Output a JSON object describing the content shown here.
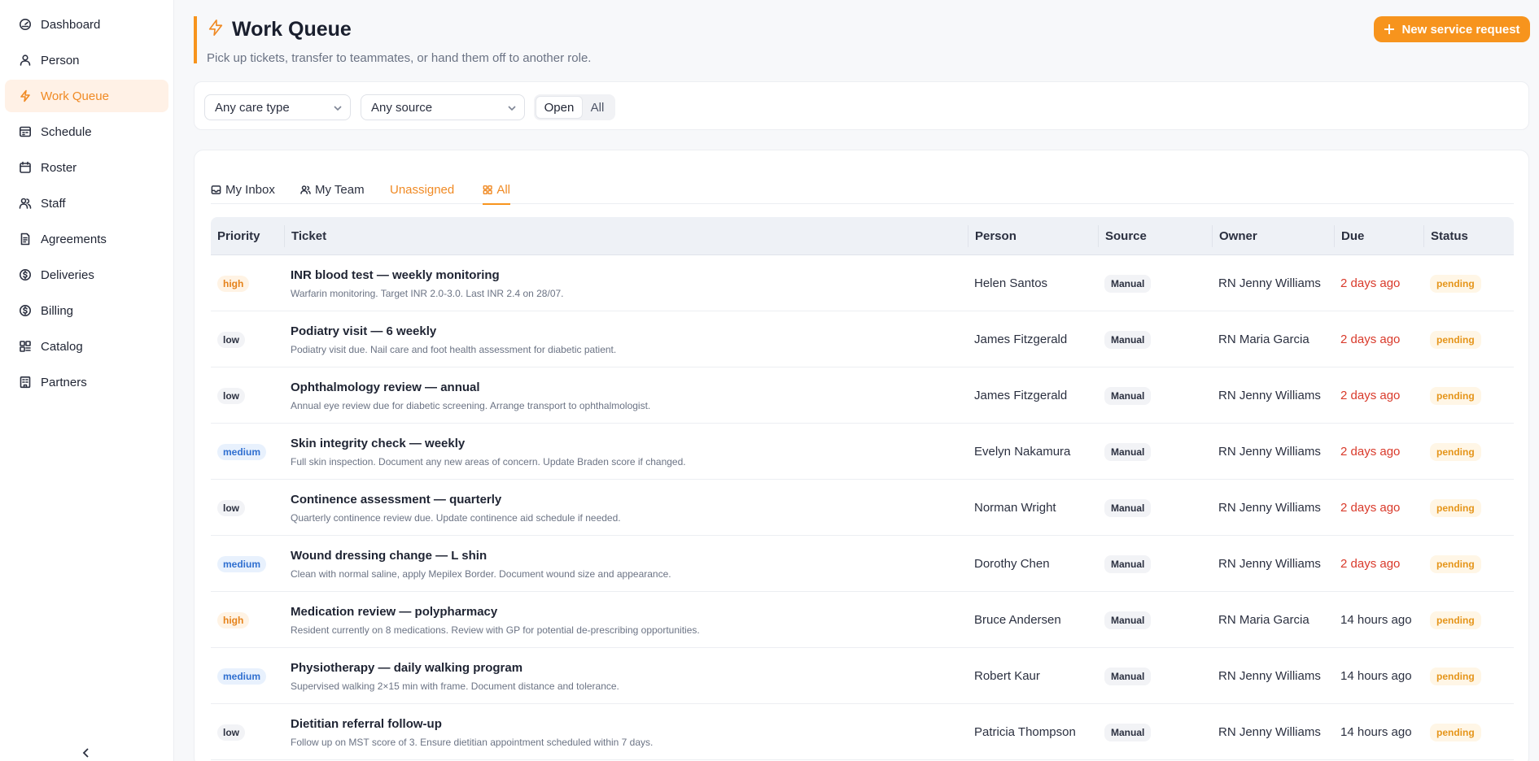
{
  "sidebar": {
    "items": [
      {
        "label": "Dashboard",
        "icon": "gauge-icon"
      },
      {
        "label": "Person",
        "icon": "user-icon"
      },
      {
        "label": "Work Queue",
        "icon": "bolt-icon",
        "active": true
      },
      {
        "label": "Schedule",
        "icon": "schedule-icon"
      },
      {
        "label": "Roster",
        "icon": "calendar-icon"
      },
      {
        "label": "Staff",
        "icon": "users-icon"
      },
      {
        "label": "Agreements",
        "icon": "document-icon"
      },
      {
        "label": "Deliveries",
        "icon": "dollar-circle-icon"
      },
      {
        "label": "Billing",
        "icon": "dollar-circle-icon"
      },
      {
        "label": "Catalog",
        "icon": "catalog-icon"
      },
      {
        "label": "Partners",
        "icon": "building-icon"
      }
    ]
  },
  "header": {
    "title": "Work Queue",
    "subtitle": "Pick up tickets, transfer to teammates, or hand them off to another role.",
    "new_button": "New service request"
  },
  "filters": {
    "care_type": "Any care type",
    "source": "Any source",
    "toggle": {
      "open": "Open",
      "all": "All",
      "selected": "Open"
    }
  },
  "tabs": [
    {
      "label": "My Inbox",
      "icon": "inbox-icon"
    },
    {
      "label": "My Team",
      "icon": "team-icon"
    },
    {
      "label": "Unassigned",
      "icon": ""
    },
    {
      "label": "All",
      "icon": "grid-icon",
      "active": true
    }
  ],
  "table": {
    "columns": [
      "Priority",
      "Ticket",
      "Person",
      "Source",
      "Owner",
      "Due",
      "Status"
    ],
    "rows": [
      {
        "priority": "high",
        "title": "INR blood test — weekly monitoring",
        "desc": "Warfarin monitoring. Target INR 2.0-3.0. Last INR 2.4 on 28/07.",
        "person": "Helen Santos",
        "source": "Manual",
        "owner": "RN Jenny Williams",
        "due": "2 days ago",
        "overdue": true,
        "status": "pending"
      },
      {
        "priority": "low",
        "title": "Podiatry visit — 6 weekly",
        "desc": "Podiatry visit due. Nail care and foot health assessment for diabetic patient.",
        "person": "James Fitzgerald",
        "source": "Manual",
        "owner": "RN Maria Garcia",
        "due": "2 days ago",
        "overdue": true,
        "status": "pending"
      },
      {
        "priority": "low",
        "title": "Ophthalmology review — annual",
        "desc": "Annual eye review due for diabetic screening. Arrange transport to ophthalmologist.",
        "person": "James Fitzgerald",
        "source": "Manual",
        "owner": "RN Jenny Williams",
        "due": "2 days ago",
        "overdue": true,
        "status": "pending"
      },
      {
        "priority": "medium",
        "title": "Skin integrity check — weekly",
        "desc": "Full skin inspection. Document any new areas of concern. Update Braden score if changed.",
        "person": "Evelyn Nakamura",
        "source": "Manual",
        "owner": "RN Jenny Williams",
        "due": "2 days ago",
        "overdue": true,
        "status": "pending"
      },
      {
        "priority": "low",
        "title": "Continence assessment — quarterly",
        "desc": "Quarterly continence review due. Update continence aid schedule if needed.",
        "person": "Norman Wright",
        "source": "Manual",
        "owner": "RN Jenny Williams",
        "due": "2 days ago",
        "overdue": true,
        "status": "pending"
      },
      {
        "priority": "medium",
        "title": "Wound dressing change — L shin",
        "desc": "Clean with normal saline, apply Mepilex Border. Document wound size and appearance.",
        "person": "Dorothy Chen",
        "source": "Manual",
        "owner": "RN Jenny Williams",
        "due": "2 days ago",
        "overdue": true,
        "status": "pending"
      },
      {
        "priority": "high",
        "title": "Medication review — polypharmacy",
        "desc": "Resident currently on 8 medications. Review with GP for potential de-prescribing opportunities.",
        "person": "Bruce Andersen",
        "source": "Manual",
        "owner": "RN Maria Garcia",
        "due": "14 hours ago",
        "overdue": false,
        "status": "pending"
      },
      {
        "priority": "medium",
        "title": "Physiotherapy — daily walking program",
        "desc": "Supervised walking 2×15 min with frame. Document distance and tolerance.",
        "person": "Robert Kaur",
        "source": "Manual",
        "owner": "RN Jenny Williams",
        "due": "14 hours ago",
        "overdue": false,
        "status": "pending"
      },
      {
        "priority": "low",
        "title": "Dietitian referral follow-up",
        "desc": "Follow up on MST score of 3. Ensure dietitian appointment scheduled within 7 days.",
        "person": "Patricia Thompson",
        "source": "Manual",
        "owner": "RN Jenny Williams",
        "due": "14 hours ago",
        "overdue": false,
        "status": "pending"
      }
    ]
  },
  "colors": {
    "accent": "#f7941d",
    "overdue": "#d93a2b"
  }
}
